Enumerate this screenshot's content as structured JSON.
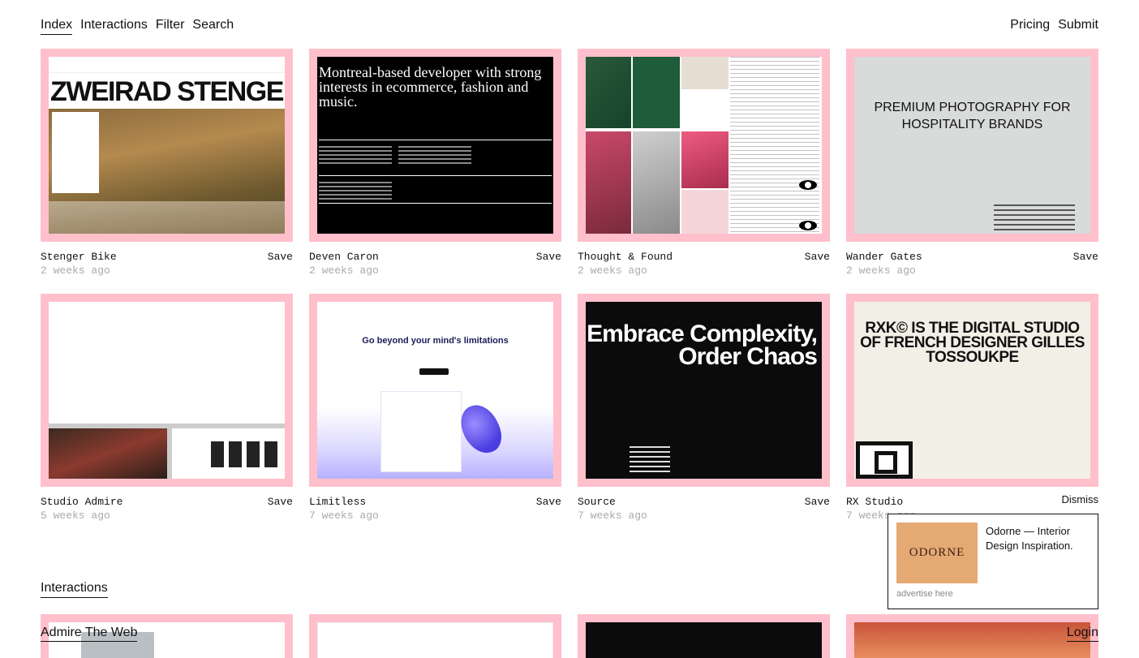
{
  "nav": {
    "left": [
      "Index",
      "Interactions",
      "Filter",
      "Search"
    ],
    "right": [
      "Pricing",
      "Submit"
    ]
  },
  "cards": [
    {
      "name": "Stenger Bike",
      "time": "2 weeks ago",
      "save": "Save",
      "headline": "ZWEIRAD STENGER®"
    },
    {
      "name": "Deven Caron",
      "time": "2 weeks ago",
      "save": "Save",
      "headline": "Montreal-based developer with strong interests in ecommerce, fashion and music."
    },
    {
      "name": "Thought & Found",
      "time": "2 weeks ago",
      "save": "Save"
    },
    {
      "name": "Wander Gates",
      "time": "2 weeks ago",
      "save": "Save",
      "headline": "PREMIUM PHOTOGRAPHY FOR HOSPITALITY BRANDS"
    },
    {
      "name": "Studio Admire",
      "time": "5 weeks ago",
      "save": "Save"
    },
    {
      "name": "Limitless",
      "time": "7 weeks ago",
      "save": "Save",
      "headline": "Go beyond your mind's limitations"
    },
    {
      "name": "Source",
      "time": "7 weeks ago",
      "save": "Save",
      "headline": "Embrace Complexity, Order Chaos"
    },
    {
      "name": "RX Studio",
      "time": "7 weeks ago",
      "save": "Save",
      "headline": "RXK© IS THE DIGITAL STUDIO OF FRENCH DESIGNER GILLES TOSSOUKPE"
    }
  ],
  "section": {
    "title": "Interactions"
  },
  "ad": {
    "dismiss": "Dismiss",
    "logo": "ODORNE",
    "text": "Odorne — Interior Design Inspiration.",
    "advertise": "advertise here"
  },
  "footer": {
    "left": "Admire The Web",
    "right": "Login"
  }
}
